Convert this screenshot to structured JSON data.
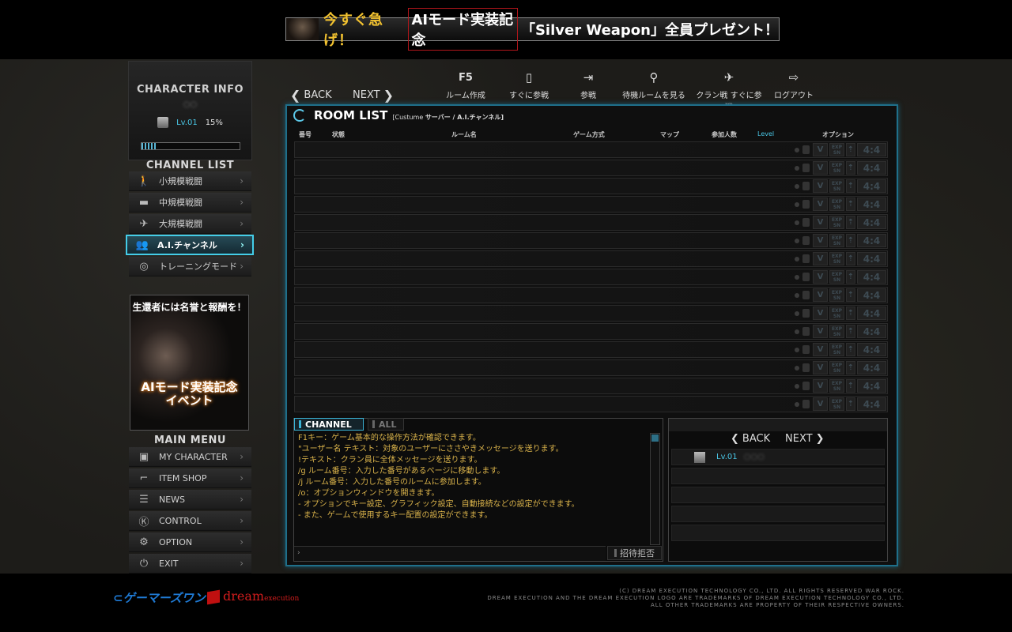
{
  "banner": {
    "highlight": "今すぐ急げ！",
    "boxed": "AIモード実装記念",
    "rest": "「Silver Weapon」全員プレゼント！"
  },
  "character": {
    "title": "CHARACTER INFO",
    "name": "○○",
    "level": "Lv.01",
    "exp_percent": "15%",
    "exp_fraction": 0.15
  },
  "channel_list": {
    "title": "CHANNEL LIST",
    "items": [
      {
        "label": "小規模戦闘",
        "icon": "soldier-icon"
      },
      {
        "label": "中規模戦闘",
        "icon": "tank-icon"
      },
      {
        "label": "大規模戦闘",
        "icon": "jet-icon"
      },
      {
        "label": "A.I.チャンネル",
        "icon": "ai-icon",
        "active": true
      },
      {
        "label": "トレーニングモード",
        "icon": "target-icon"
      }
    ]
  },
  "event": {
    "top": "生還者には名誉と報酬を！",
    "line1": "AIモード実装記念",
    "line2": "イベント"
  },
  "main_menu": {
    "title": "MAIN MENU",
    "items": [
      {
        "label": "MY CHARACTER",
        "icon": "character-icon"
      },
      {
        "label": "ITEM SHOP",
        "icon": "gun-icon"
      },
      {
        "label": "NEWS",
        "icon": "news-icon"
      },
      {
        "label": "CONTROL",
        "icon": "keyboard-icon"
      },
      {
        "label": "OPTION",
        "icon": "gear-icon"
      },
      {
        "label": "EXIT",
        "icon": "power-icon"
      }
    ]
  },
  "nav": {
    "back": "BACK",
    "next": "NEXT",
    "tools": [
      {
        "icon": "F5",
        "label": "ルーム作成"
      },
      {
        "icon": "quick-join-icon",
        "label": "すぐに参戦"
      },
      {
        "icon": "join-icon",
        "label": "参戦"
      },
      {
        "icon": "search-icon",
        "label": "待機ルームを見る"
      },
      {
        "icon": "plane-icon",
        "label": "クラン戦 すぐに参戦"
      },
      {
        "icon": "logout-icon",
        "label": "ログアウト"
      }
    ]
  },
  "room_list": {
    "title": "ROOM LIST",
    "server_prefix": "[Custume",
    "server_name": "サーバー / A.I.チャンネル]",
    "columns": {
      "no": "番号",
      "status": "状態",
      "room_name": "ルーム名",
      "mode": "ゲーム方式",
      "map": "マップ",
      "players": "参加人数",
      "level": "Level",
      "options": "オプション"
    },
    "row_count": 15,
    "row_options": {
      "v": "V",
      "exp": "EXP SN",
      "arrow": "⇡",
      "score": "4:4"
    }
  },
  "chat": {
    "tab_channel": "CHANNEL",
    "tab_all": "ALL",
    "lines": [
      "F1キー：ゲーム基本的な操作方法が確認できます。",
      "\"ユーザー名 テキスト：対象のユーザーにささやきメッセージを送ります。",
      "!テキスト：クラン員に全体メッセージを送ります。",
      "/g ルーム番号：入力した番号があるページに移動します。",
      "/j ルーム番号：入力した番号のルームに参加します。",
      "/o：オプションウィンドウを開きます。",
      "- オプションでキー設定、グラフィック設定、自動接続などの設定ができます。",
      "- また、ゲームで使用するキー配置の設定ができます。"
    ],
    "reject_label": "招待拒否"
  },
  "users": {
    "back": "BACK",
    "next": "NEXT",
    "entries": [
      {
        "level": "Lv.01",
        "name": "○○○"
      }
    ]
  },
  "footer": {
    "logo_gamers": "ゲーマーズワン",
    "logo_dream": "dream",
    "logo_dream_sub": "execution",
    "copyright": [
      "(C) DREAM EXECUTION TECHNOLOGY CO., LTD. ALL RIGHTS RESERVED WAR ROCK.",
      "DREAM EXECUTION AND THE DREAM EXECUTION LOGO ARE TRADEMARKS OF DREAM EXECUTION TECHNOLOGY CO., LTD.",
      "ALL OTHER TRADEMARKS ARE PROPERTY OF THEIR RESPECTIVE OWNERS."
    ]
  }
}
